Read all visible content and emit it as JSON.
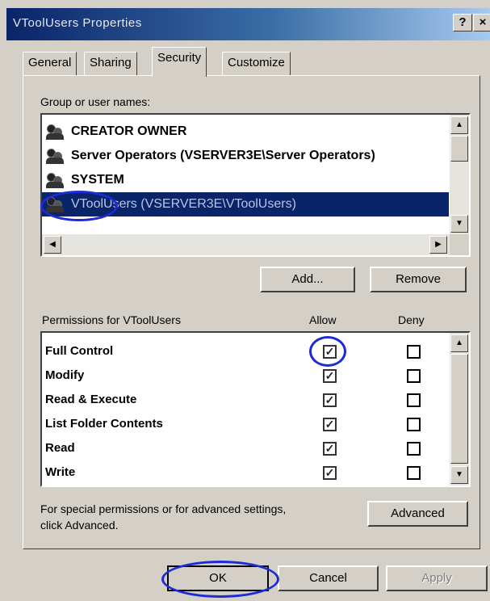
{
  "window": {
    "title": "VToolUsers Properties",
    "help_button": "?",
    "close_button": "×"
  },
  "tabs": [
    {
      "label": "General"
    },
    {
      "label": "Sharing"
    },
    {
      "label": "Security"
    },
    {
      "label": "Customize"
    }
  ],
  "users": {
    "label": "Group or user names:",
    "items": [
      {
        "name": "CREATOR OWNER"
      },
      {
        "name": "Server Operators (VSERVER3E\\Server Operators)"
      },
      {
        "name": "SYSTEM"
      },
      {
        "name": "VToolUsers (VSERVER3E\\VToolUsers)"
      }
    ],
    "add_label": "Add...",
    "remove_label": "Remove"
  },
  "permissions": {
    "label": "Permissions for VToolUsers",
    "allow_header": "Allow",
    "deny_header": "Deny",
    "check_glyph": "✓",
    "rows": [
      {
        "name": "Full Control",
        "allow": true,
        "deny": false
      },
      {
        "name": "Modify",
        "allow": true,
        "deny": false
      },
      {
        "name": "Read & Execute",
        "allow": true,
        "deny": false
      },
      {
        "name": "List Folder Contents",
        "allow": true,
        "deny": false
      },
      {
        "name": "Read",
        "allow": true,
        "deny": false
      },
      {
        "name": "Write",
        "allow": true,
        "deny": false
      }
    ]
  },
  "advanced": {
    "note_line1": "For special permissions or for advanced settings,",
    "note_line2": "click Advanced.",
    "button_label": "Advanced"
  },
  "footer": {
    "ok_label": "OK",
    "cancel_label": "Cancel",
    "apply_label": "Apply"
  },
  "colors": {
    "face": "#d4d0c8",
    "title_blue": "#0a246a",
    "highlight_ring": "#1d2ad8"
  }
}
